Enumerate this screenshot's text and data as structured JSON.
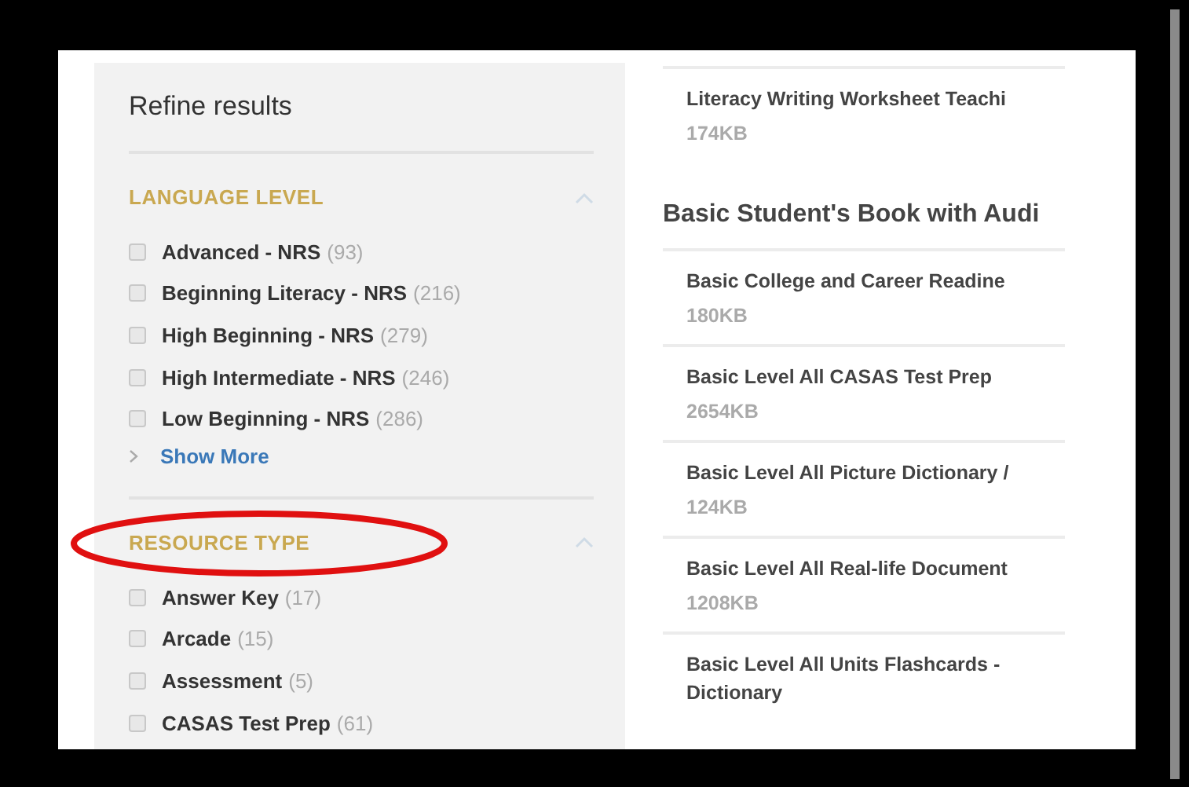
{
  "sidebar": {
    "title": "Refine results",
    "sections": [
      {
        "heading": "LANGUAGE LEVEL",
        "expanded": true,
        "highlighted": false,
        "options": [
          {
            "label": "Advanced - NRS",
            "count": "(93)",
            "checked": false
          },
          {
            "label": "Beginning Literacy - NRS",
            "count": "(216)",
            "checked": false
          },
          {
            "label": "High Beginning - NRS",
            "count": "(279)",
            "checked": false
          },
          {
            "label": "High Intermediate - NRS",
            "count": "(246)",
            "checked": false
          },
          {
            "label": "Low Beginning - NRS",
            "count": "(286)",
            "checked": false
          }
        ],
        "show_more": "Show More"
      },
      {
        "heading": "RESOURCE TYPE",
        "expanded": true,
        "highlighted": true,
        "options": [
          {
            "label": "Answer Key",
            "count": "(17)",
            "checked": false
          },
          {
            "label": "Arcade",
            "count": "(15)",
            "checked": false
          },
          {
            "label": "Assessment",
            "count": "(5)",
            "checked": false
          },
          {
            "label": "CASAS Test Prep",
            "count": "(61)",
            "checked": false
          }
        ]
      }
    ]
  },
  "results": [
    {
      "kind": "file",
      "title": "Literacy Writing Worksheet Teachi",
      "size": "174KB"
    },
    {
      "kind": "heading",
      "title": "Basic Student's Book with Audi"
    },
    {
      "kind": "file",
      "title": "Basic College and Career Readine",
      "size": "180KB"
    },
    {
      "kind": "file",
      "title": "Basic Level All CASAS Test Prep",
      "size": "2654KB"
    },
    {
      "kind": "file",
      "title": "Basic Level All Picture Dictionary /",
      "size": "124KB"
    },
    {
      "kind": "file",
      "title": "Basic Level All Real-life Document",
      "size": "1208KB"
    },
    {
      "kind": "file",
      "title": "Basic Level All Units Flashcards - Dictionary"
    }
  ]
}
